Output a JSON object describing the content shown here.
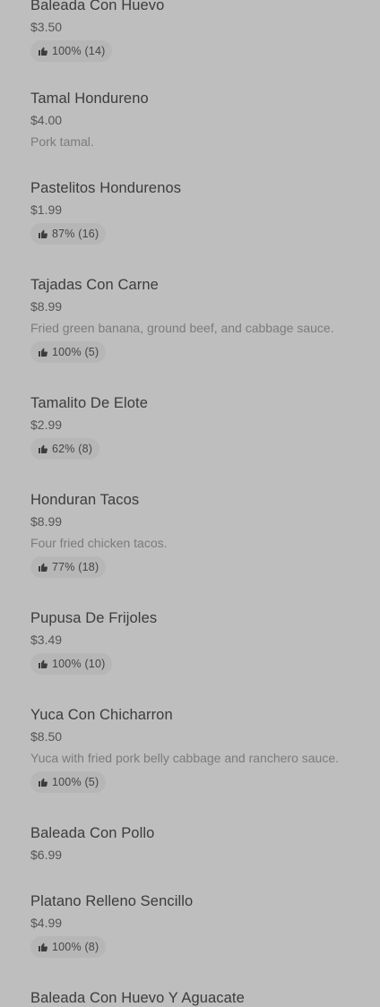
{
  "menu": {
    "items": [
      {
        "name": "Baleada Con Huevo",
        "price": "$3.50",
        "rating": "100% (14)"
      },
      {
        "name": "Tamal Hondureno",
        "price": "$4.00",
        "description": "Pork tamal."
      },
      {
        "name": "Pastelitos Hondurenos",
        "price": "$1.99",
        "rating": "87% (16)"
      },
      {
        "name": "Tajadas Con Carne",
        "price": "$8.99",
        "description": "Fried green banana, ground beef, and cabbage sauce.",
        "rating": "100% (5)"
      },
      {
        "name": "Tamalito De Elote",
        "price": "$2.99",
        "rating": "62% (8)"
      },
      {
        "name": "Honduran Tacos",
        "price": "$8.99",
        "description": "Four fried chicken tacos.",
        "rating": "77% (18)"
      },
      {
        "name": "Pupusa De Frijoles",
        "price": "$3.49",
        "rating": "100% (10)"
      },
      {
        "name": "Yuca Con Chicharron",
        "price": "$8.50",
        "description": "Yuca with fried pork belly cabbage and ranchero sauce.",
        "rating": "100% (5)"
      },
      {
        "name": "Baleada Con Pollo",
        "price": "$6.99"
      },
      {
        "name": "Platano Relleno Sencillo",
        "price": "$4.99",
        "rating": "100% (8)"
      },
      {
        "name": "Baleada Con Huevo Y Aguacate"
      }
    ]
  },
  "icons": {
    "rating": "thumbs-up-icon"
  }
}
